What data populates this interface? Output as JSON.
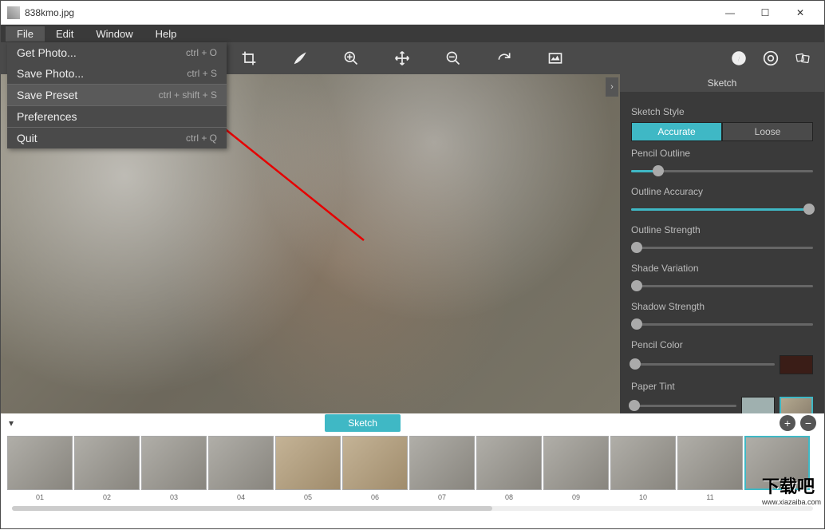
{
  "window": {
    "title": "838kmo.jpg"
  },
  "menubar": {
    "items": [
      "File",
      "Edit",
      "Window",
      "Help"
    ],
    "active": 0
  },
  "dropdown": {
    "items": [
      {
        "label": "Get Photo...",
        "shortcut": "ctrl + O"
      },
      {
        "label": "Save Photo...",
        "shortcut": "ctrl + S"
      },
      {
        "label": "Save Preset",
        "shortcut": "ctrl + shift + S",
        "highlight": true
      },
      {
        "label": "Preferences",
        "shortcut": ""
      },
      {
        "label": "Quit",
        "shortcut": "ctrl + Q"
      }
    ]
  },
  "panel": {
    "title": "Sketch",
    "style_label": "Sketch Style",
    "accurate": "Accurate",
    "loose": "Loose",
    "sliders": {
      "pencil_outline": {
        "label": "Pencil Outline",
        "pct": 15
      },
      "outline_accuracy": {
        "label": "Outline Accuracy",
        "pct": 98
      },
      "outline_strength": {
        "label": "Outline Strength",
        "pct": 3
      },
      "shade_variation": {
        "label": "Shade Variation",
        "pct": 3
      },
      "shadow_strength": {
        "label": "Shadow Strength",
        "pct": 3
      }
    },
    "pencil_color": {
      "label": "Pencil Color",
      "pct": 3,
      "hex": "#3a1d17"
    },
    "paper_tint": {
      "label": "Paper Tint",
      "pct": 3,
      "hex": "#9fb0af"
    }
  },
  "preset": {
    "button": "Sketch"
  },
  "thumbs": [
    "01",
    "02",
    "03",
    "04",
    "05",
    "06",
    "07",
    "08",
    "09",
    "10",
    "11",
    ""
  ],
  "watermark": {
    "text": "下载吧",
    "url": "www.xiazaiba.com"
  }
}
